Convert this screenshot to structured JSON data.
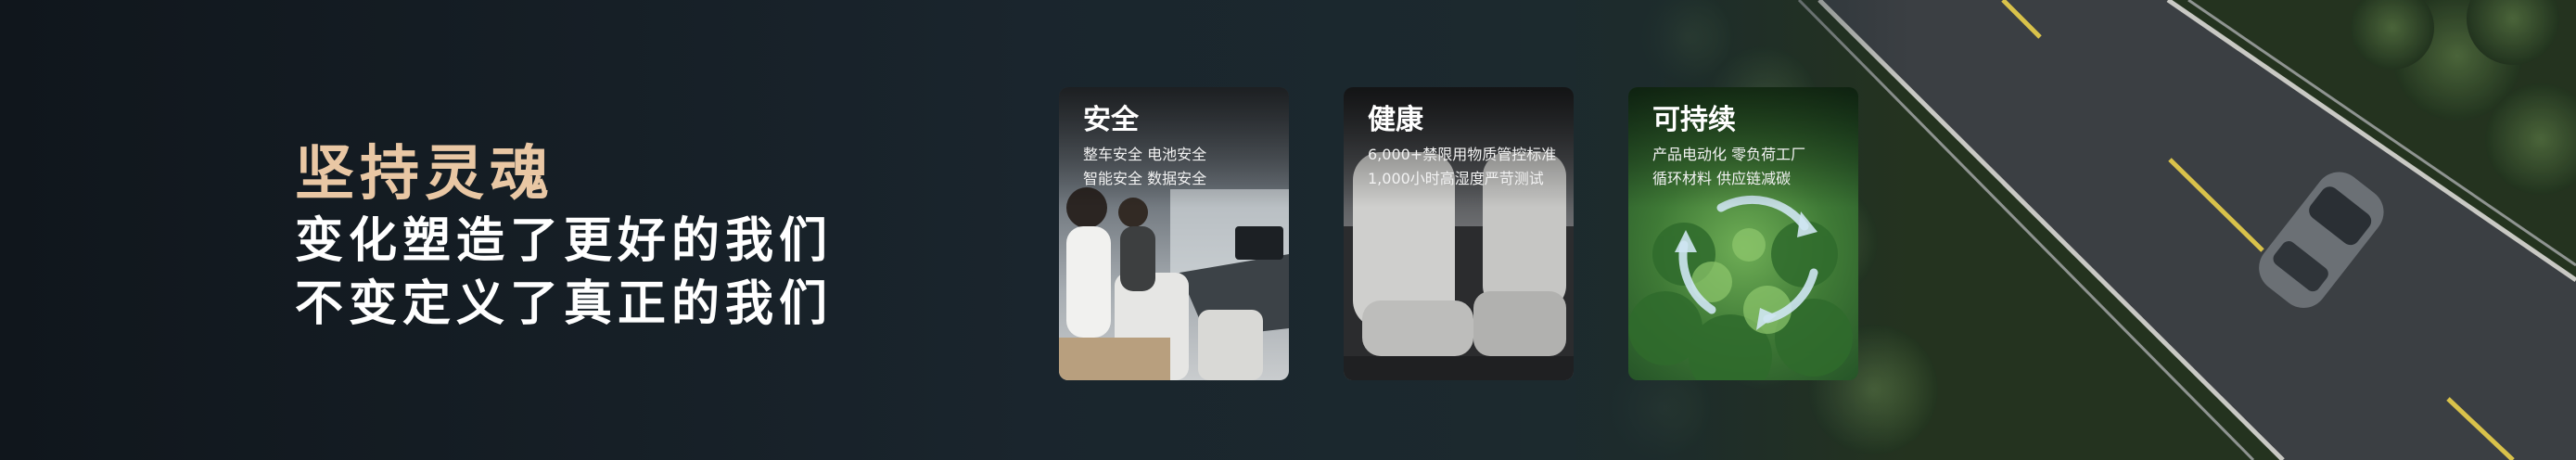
{
  "slogan": {
    "title": "坚持灵魂",
    "line1": "变化塑造了更好的我们",
    "line2": "不变定义了真正的我们"
  },
  "cards": [
    {
      "title": "安全",
      "lines": [
        "整车安全  电池安全",
        "智能安全  数据安全"
      ]
    },
    {
      "title": "健康",
      "lines": [
        "6,000+禁限用物质管控标准",
        "1,000小时高湿度严苛测试"
      ]
    },
    {
      "title": "可持续",
      "lines": [
        "产品电动化  零负荷工厂",
        "循环材料  供应链减碳"
      ]
    }
  ],
  "colors": {
    "accent_title": "#e9c7a4",
    "text": "#ffffff",
    "background": "#141c22",
    "road": "#3b3f43",
    "forest": "#2f4a2a"
  }
}
